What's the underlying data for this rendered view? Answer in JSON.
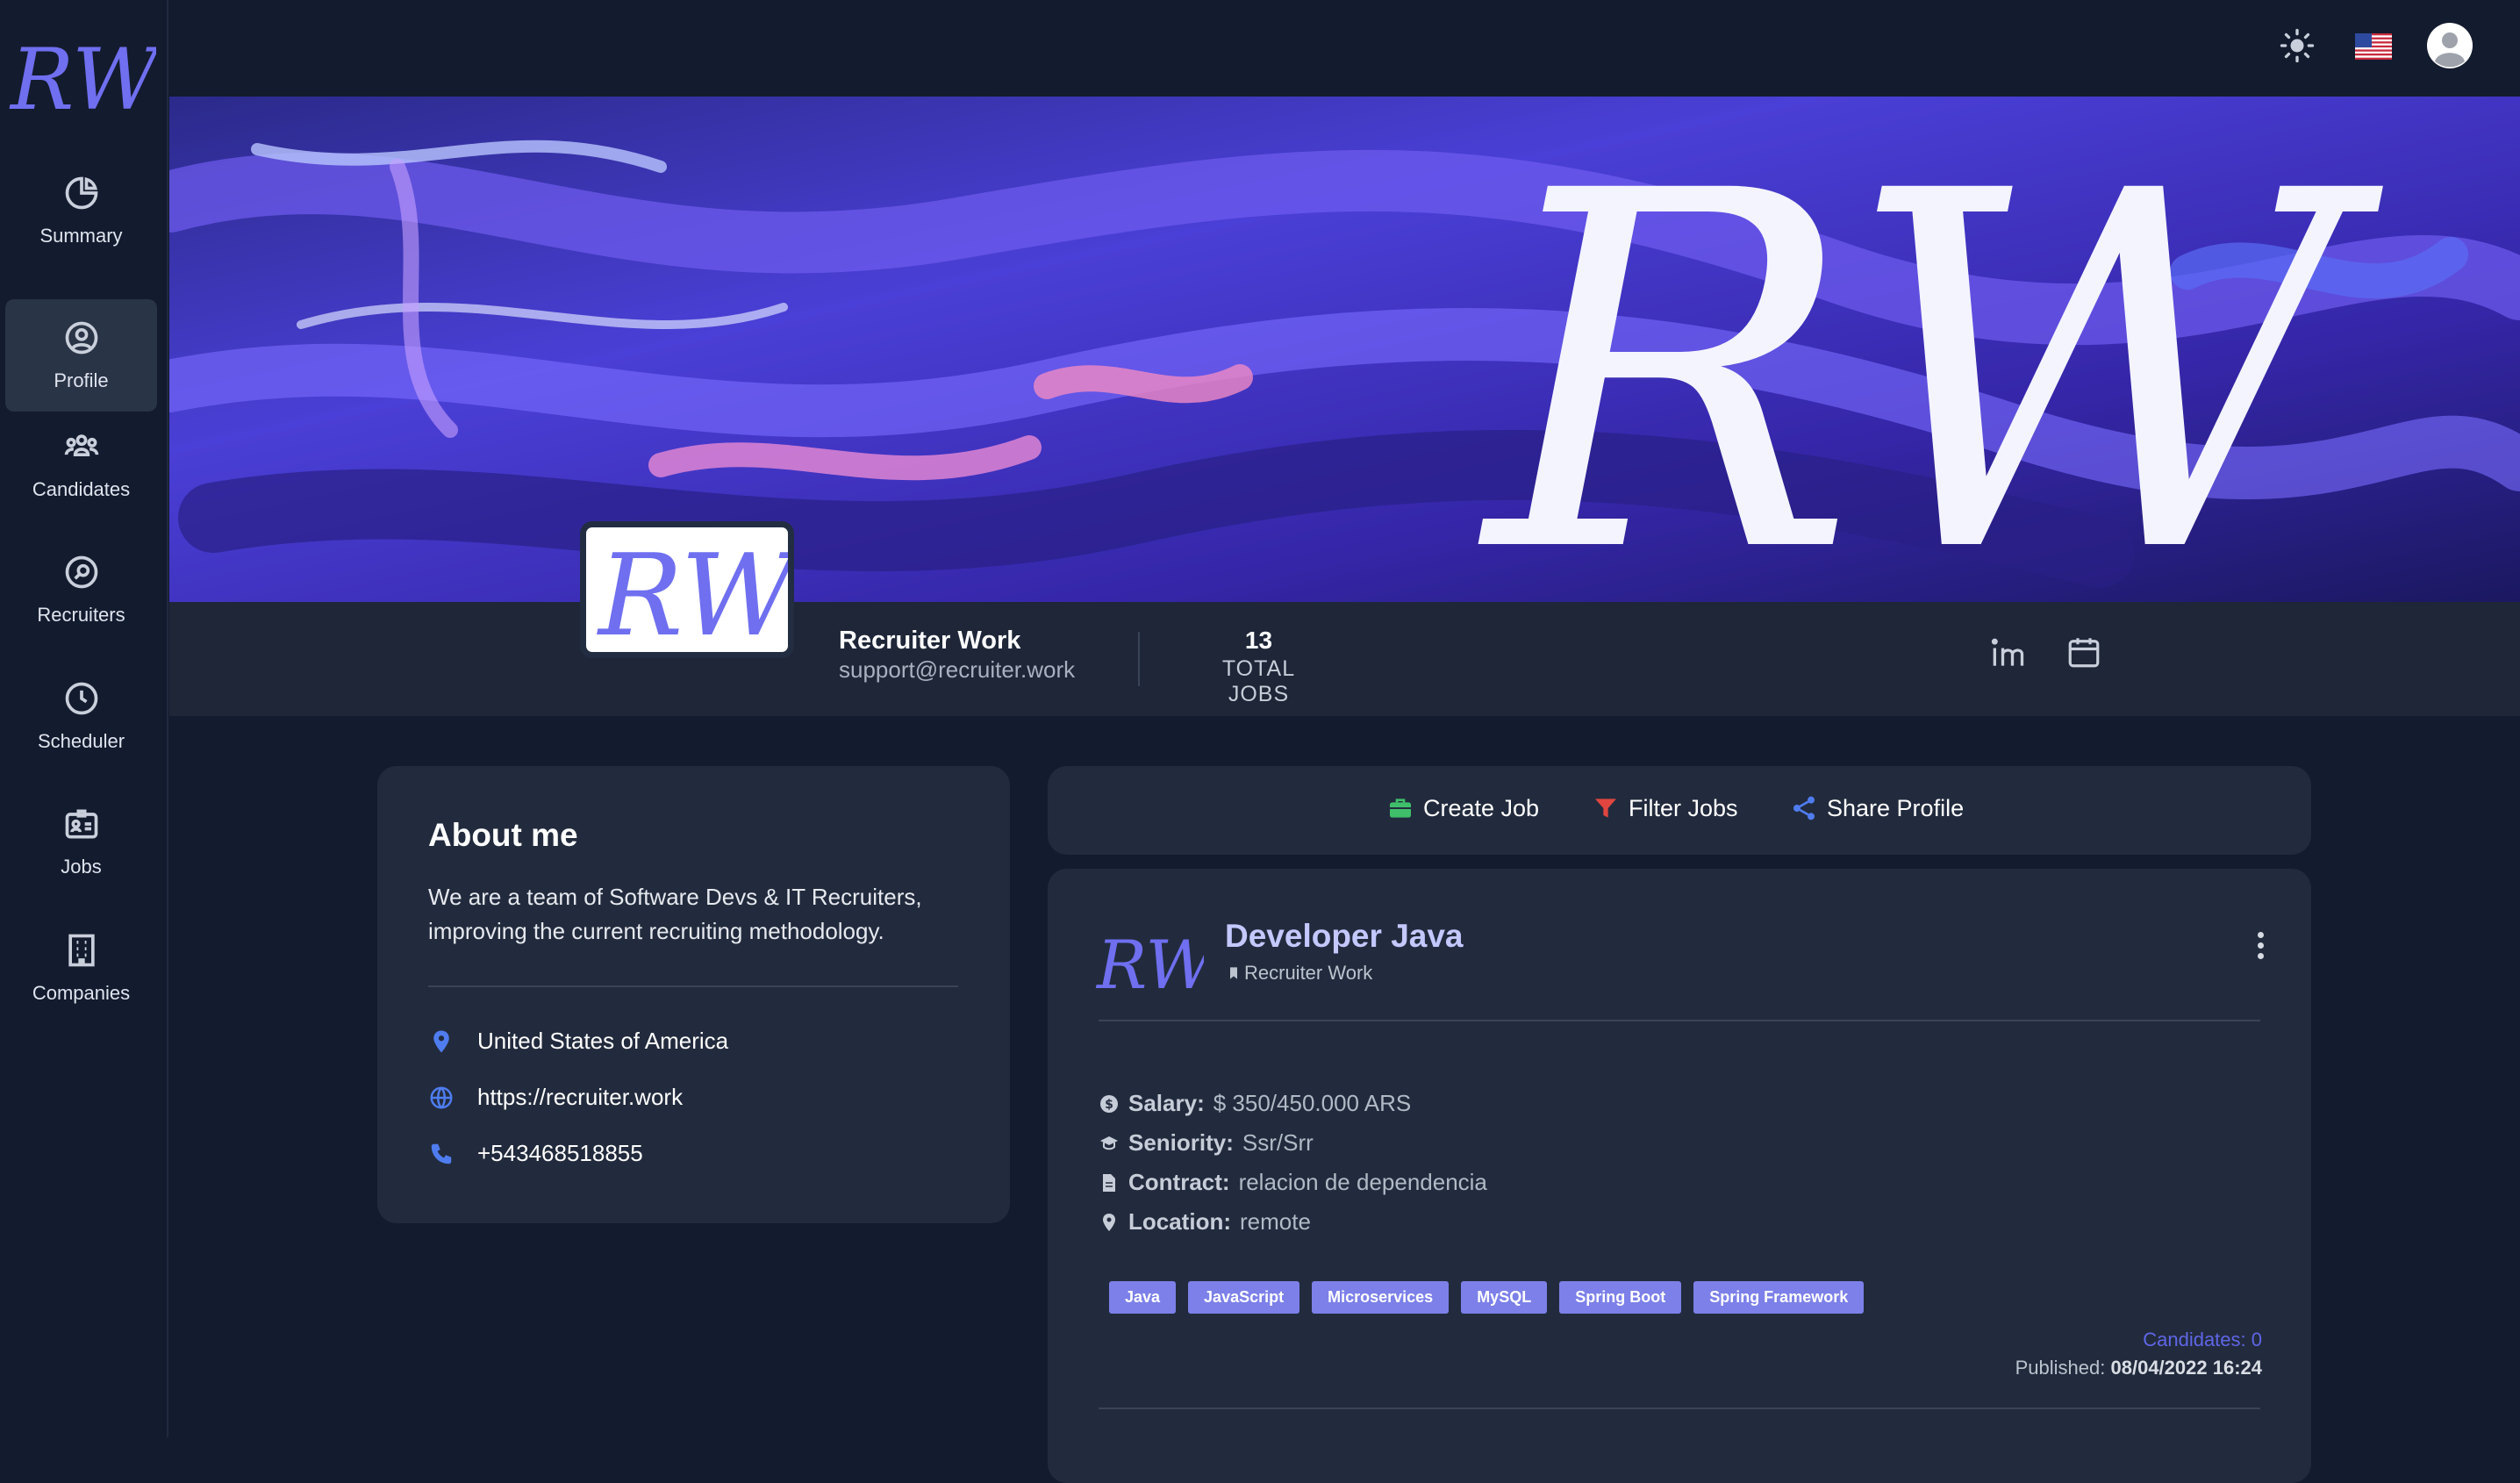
{
  "brand": {
    "logo_text": "RW"
  },
  "sidebar": {
    "items": [
      {
        "label": "Summary",
        "icon": "pie-chart-icon"
      },
      {
        "label": "Profile",
        "icon": "user-circle-icon",
        "active": true
      },
      {
        "label": "Candidates",
        "icon": "group-icon"
      },
      {
        "label": "Recruiters",
        "icon": "search-circle-icon"
      },
      {
        "label": "Scheduler",
        "icon": "clock-icon"
      },
      {
        "label": "Jobs",
        "icon": "id-card-icon"
      },
      {
        "label": "Companies",
        "icon": "building-icon"
      }
    ]
  },
  "topbar": {
    "icons": [
      "sun-icon",
      "us-flag-icon",
      "user-avatar-icon"
    ]
  },
  "banner": {
    "text": "RW"
  },
  "profile": {
    "name": "Recruiter Work",
    "email": "support@recruiter.work",
    "total_jobs_count": "13",
    "total_jobs_label": "TOTAL JOBS",
    "icons": [
      "linkedin-icon",
      "calendar-icon"
    ]
  },
  "about": {
    "title": "About me",
    "text": "We are a team of Software Devs & IT Recruiters, improving the current recruiting methodology.",
    "location": "United States of America",
    "website": "https://recruiter.work",
    "phone": "+543468518855"
  },
  "actions": {
    "create_job": "Create Job",
    "filter_jobs": "Filter Jobs",
    "share_profile": "Share Profile"
  },
  "job": {
    "logo_text": "RW",
    "title": "Developer Java",
    "company": "Recruiter Work",
    "salary_key": "Salary:",
    "salary": "$ 350/450.000 ARS",
    "seniority_key": "Seniority:",
    "seniority": "Ssr/Srr",
    "contract_key": "Contract:",
    "contract": "relacion de dependencia",
    "location_key": "Location:",
    "location": "remote",
    "tags": [
      "Java",
      "JavaScript",
      "Microservices",
      "MySQL",
      "Spring Boot",
      "Spring Framework"
    ],
    "candidates_label": "Candidates: 0",
    "published_label": "Published:",
    "published_date": "08/04/2022 16:24"
  },
  "colors": {
    "accent": "#7c80e8",
    "background": "#131b2e",
    "card": "#222b3d",
    "link": "#5f66e6"
  }
}
